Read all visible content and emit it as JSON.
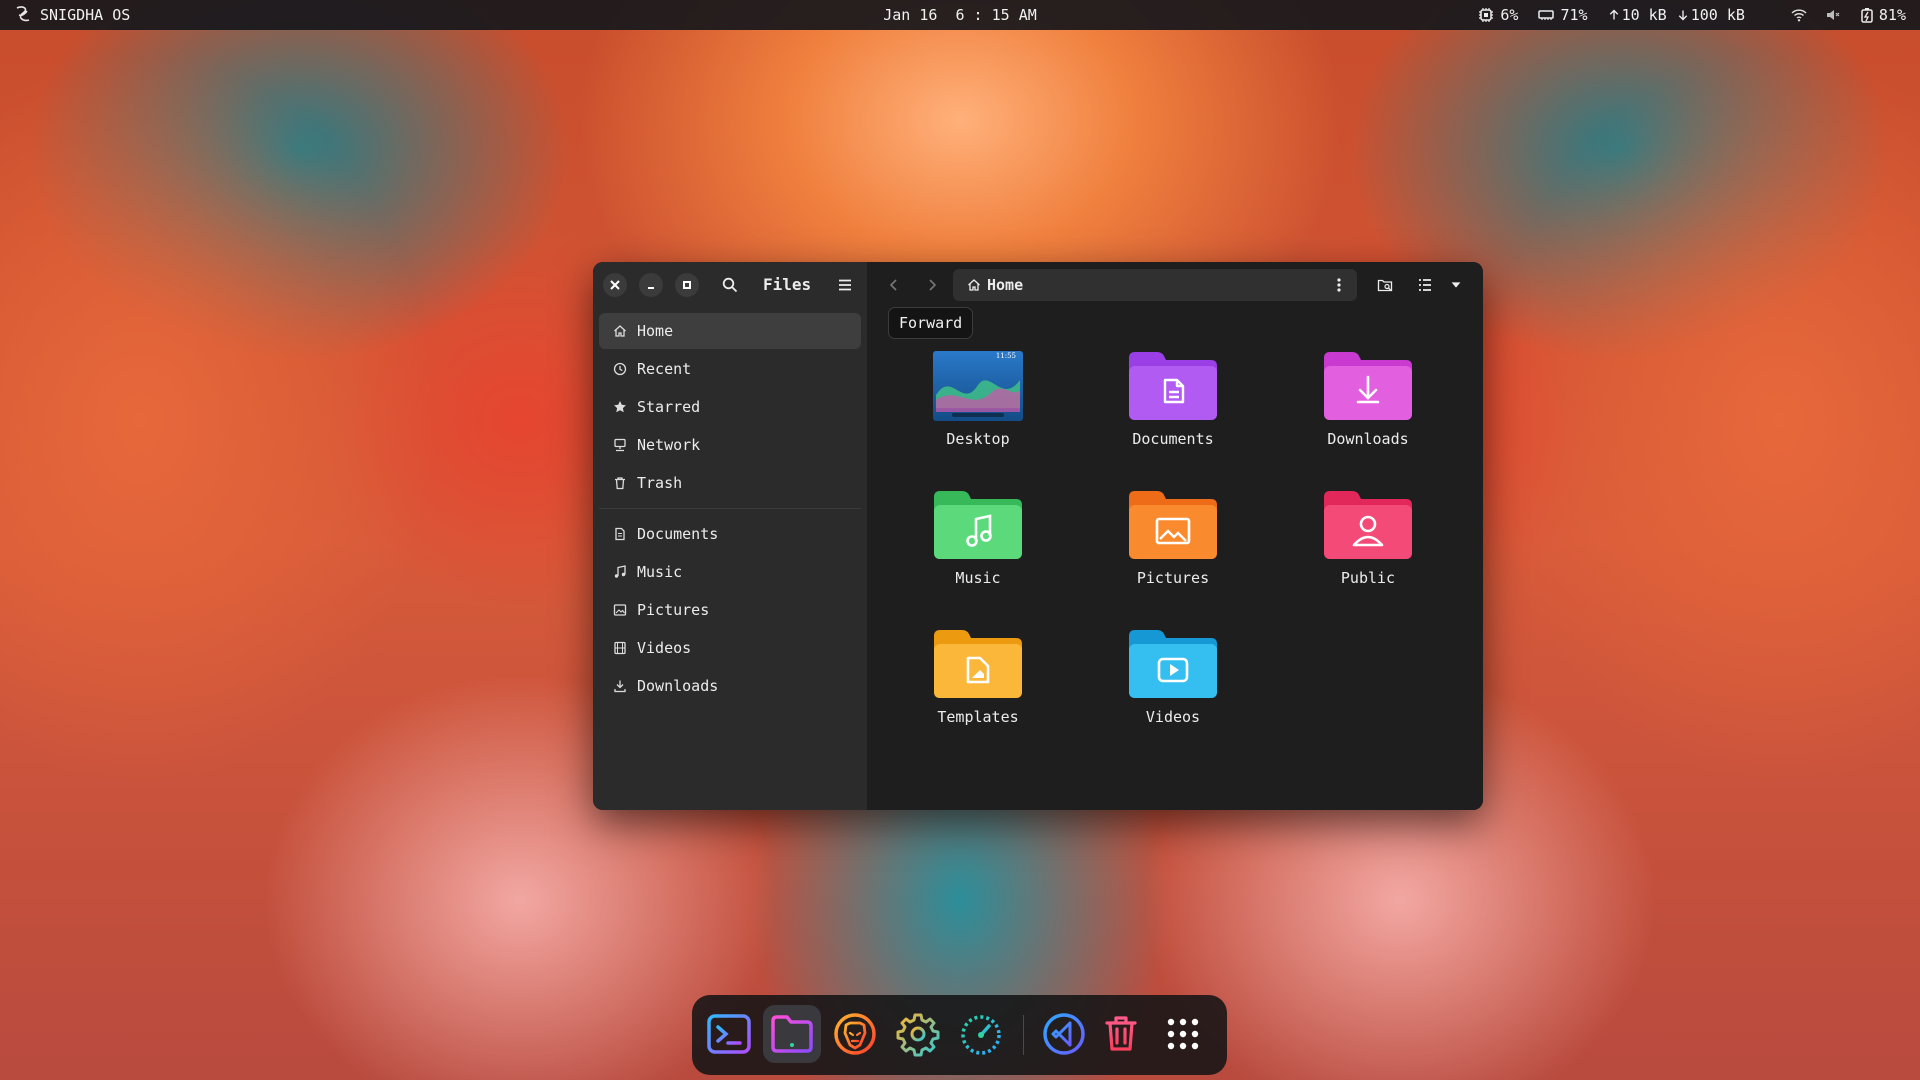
{
  "topbar": {
    "os_name": "SNIGDHA OS",
    "datetime": "Jan 16  6 : 15 AM",
    "cpu": "6%",
    "ram": "71%",
    "upload": "10 kB",
    "download": "100 kB",
    "battery": "81%",
    "icons": {
      "logo": "snigdha-logo-icon",
      "cpu": "cpu-icon",
      "ram": "ram-icon",
      "up": "arrow-up-icon",
      "down": "arrow-down-icon",
      "wifi": "wifi-icon",
      "volume": "volume-icon",
      "battery": "battery-icon"
    }
  },
  "window": {
    "title": "Files",
    "path_label": "Home",
    "tooltip": "Forward",
    "sidebar": {
      "places": [
        {
          "label": "Home",
          "icon": "home-icon",
          "active": true
        },
        {
          "label": "Recent",
          "icon": "clock-icon"
        },
        {
          "label": "Starred",
          "icon": "star-icon"
        },
        {
          "label": "Network",
          "icon": "network-icon"
        },
        {
          "label": "Trash",
          "icon": "trash-icon"
        }
      ],
      "bookmarks": [
        {
          "label": "Documents",
          "icon": "document-icon"
        },
        {
          "label": "Music",
          "icon": "music-note-icon"
        },
        {
          "label": "Pictures",
          "icon": "image-icon"
        },
        {
          "label": "Videos",
          "icon": "film-icon"
        },
        {
          "label": "Downloads",
          "icon": "download-icon"
        }
      ]
    },
    "folders": [
      {
        "label": "Desktop",
        "thumb_time": "11:55"
      },
      {
        "label": "Documents",
        "color": "#a14cf0"
      },
      {
        "label": "Downloads",
        "color": "#d848d8"
      },
      {
        "label": "Music",
        "color": "#4fd06c"
      },
      {
        "label": "Pictures",
        "color": "#f48126"
      },
      {
        "label": "Public",
        "color": "#ee3d6e"
      },
      {
        "label": "Templates",
        "color": "#f5a623"
      },
      {
        "label": "Videos",
        "color": "#20b0e6"
      }
    ]
  },
  "dock": {
    "apps": [
      {
        "name": "Terminal",
        "icon": "terminal-icon"
      },
      {
        "name": "Files",
        "icon": "folder-icon",
        "active": true
      },
      {
        "name": "Brave Browser",
        "icon": "brave-lion-icon"
      },
      {
        "name": "Settings",
        "icon": "gear-icon"
      },
      {
        "name": "System Monitor",
        "icon": "speedometer-icon"
      },
      {
        "name": "VS Code",
        "icon": "vscode-icon"
      },
      {
        "name": "Trash",
        "icon": "trash-icon"
      },
      {
        "name": "Show Apps",
        "icon": "app-grid-icon"
      }
    ]
  }
}
